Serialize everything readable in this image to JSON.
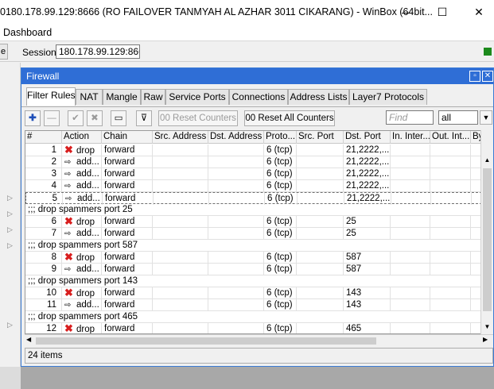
{
  "window": {
    "title": "0180.178.99.129:8666 (RO FAILOVER TANMYAH AL AZHAR 3011 CIKARANG) - WinBox (64bit...",
    "minimize_glyph": "—",
    "maximize_glyph": "☐",
    "close_glyph": "✕"
  },
  "menu": {
    "dashboard": "Dashboard"
  },
  "session": {
    "undo_stub": "e",
    "label": "Session:",
    "value": "180.178.99.129:8666",
    "status_color": "#1c8a1c"
  },
  "firewall": {
    "title": "Firewall",
    "restore_glyph": "▫",
    "close_glyph": "✕",
    "tabs": [
      {
        "label": "Filter Rules",
        "active": true
      },
      {
        "label": "NAT",
        "active": false
      },
      {
        "label": "Mangle",
        "active": false
      },
      {
        "label": "Raw",
        "active": false
      },
      {
        "label": "Service Ports",
        "active": false
      },
      {
        "label": "Connections",
        "active": false
      },
      {
        "label": "Address Lists",
        "active": false
      },
      {
        "label": "Layer7 Protocols",
        "active": false
      }
    ],
    "toolbar": {
      "add_glyph": "✚",
      "remove_glyph": "—",
      "enable_glyph": "✔",
      "disable_glyph": "✖",
      "comment_glyph": "▭",
      "filter_glyph": "⊽",
      "reset_counters": "00 Reset Counters",
      "reset_all_counters": "00 Reset All Counters",
      "find_placeholder": "Find",
      "scope_value": "all",
      "scope_arrow": "▼"
    },
    "columns": [
      "#",
      "Action",
      "Chain",
      "Src. Address",
      "Dst. Address",
      "Proto...",
      "Src. Port",
      "Dst. Port",
      "In. Inter...",
      "Out. Int...",
      "By"
    ],
    "rows": [
      {
        "kind": "rule",
        "num": "1",
        "icon": "drop",
        "action": "drop",
        "chain": "forward",
        "proto": "6 (tcp)",
        "dst_port": "21,2222,..."
      },
      {
        "kind": "rule",
        "num": "2",
        "icon": "add",
        "action": "add...",
        "chain": "forward",
        "proto": "6 (tcp)",
        "dst_port": "21,2222,..."
      },
      {
        "kind": "rule",
        "num": "3",
        "icon": "add",
        "action": "add...",
        "chain": "forward",
        "proto": "6 (tcp)",
        "dst_port": "21,2222,..."
      },
      {
        "kind": "rule",
        "num": "4",
        "icon": "add",
        "action": "add...",
        "chain": "forward",
        "proto": "6 (tcp)",
        "dst_port": "21,2222,..."
      },
      {
        "kind": "rule",
        "num": "5",
        "icon": "add",
        "action": "add...",
        "chain": "forward",
        "proto": "6 (tcp)",
        "dst_port": "21,2222,...",
        "selected": true
      },
      {
        "kind": "comment",
        "text": ";;; drop spammers port 25"
      },
      {
        "kind": "rule",
        "num": "6",
        "icon": "drop",
        "action": "drop",
        "chain": "forward",
        "proto": "6 (tcp)",
        "dst_port": "25"
      },
      {
        "kind": "rule",
        "num": "7",
        "icon": "add",
        "action": "add...",
        "chain": "forward",
        "proto": "6 (tcp)",
        "dst_port": "25"
      },
      {
        "kind": "comment",
        "text": ";;; drop spammers port 587"
      },
      {
        "kind": "rule",
        "num": "8",
        "icon": "drop",
        "action": "drop",
        "chain": "forward",
        "proto": "6 (tcp)",
        "dst_port": "587"
      },
      {
        "kind": "rule",
        "num": "9",
        "icon": "add",
        "action": "add...",
        "chain": "forward",
        "proto": "6 (tcp)",
        "dst_port": "587"
      },
      {
        "kind": "comment",
        "text": ";;; drop spammers port 143"
      },
      {
        "kind": "rule",
        "num": "10",
        "icon": "drop",
        "action": "drop",
        "chain": "forward",
        "proto": "6 (tcp)",
        "dst_port": "143"
      },
      {
        "kind": "rule",
        "num": "11",
        "icon": "add",
        "action": "add...",
        "chain": "forward",
        "proto": "6 (tcp)",
        "dst_port": "143"
      },
      {
        "kind": "comment",
        "text": ";;; drop spammers port 465"
      },
      {
        "kind": "rule",
        "num": "12",
        "icon": "drop",
        "action": "drop",
        "chain": "forward",
        "proto": "6 (tcp)",
        "dst_port": "465"
      }
    ],
    "status": "24 items",
    "scroll_glyphs": {
      "up": "▲",
      "down": "▼",
      "left": "◀",
      "right": "▶"
    }
  }
}
